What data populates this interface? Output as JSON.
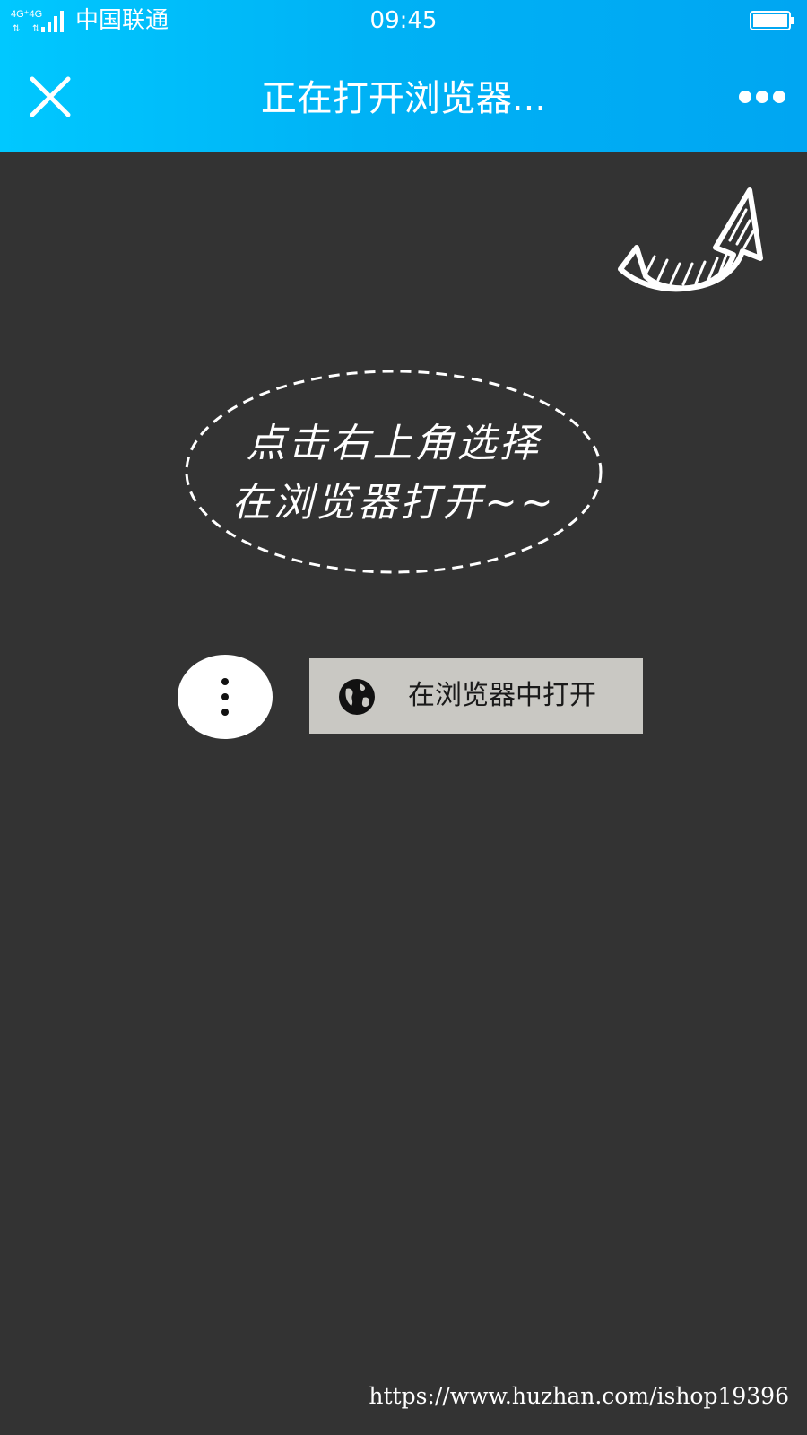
{
  "status_bar": {
    "network": "4G⁺4G",
    "carrier": "中国联通",
    "time": "09:45",
    "signal_icon": "signal-bars-icon",
    "battery_icon": "battery-icon"
  },
  "header": {
    "title": "正在打开浏览器...",
    "close_icon": "close-icon",
    "more_icon": "more-dots-icon",
    "accent_color": "#00b4f5"
  },
  "guide": {
    "arrow_icon": "curved-arrow-icon",
    "bubble_lines": [
      "点击右上角选择",
      "在浏览器打开~~"
    ],
    "menu_icon": "vertical-dots-icon",
    "open_button_icon": "globe-icon",
    "open_button_label": "在浏览器中打开"
  },
  "watermark": "https://www.huzhan.com/ishop19396",
  "colors": {
    "background": "#333333",
    "button_background": "#c9c8c3",
    "text_light": "#ffffff"
  }
}
